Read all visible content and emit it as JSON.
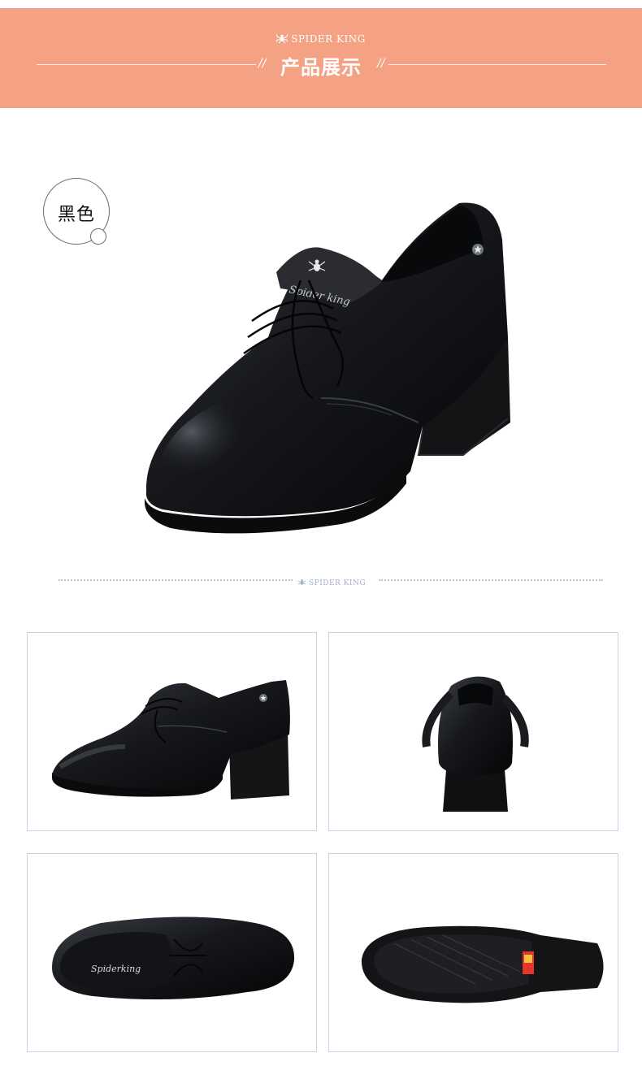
{
  "banner": {
    "brand": "SPIDER KING",
    "title": "产品展示",
    "slash": "//",
    "background": "#f5a184"
  },
  "color_badge": {
    "label": "黑色"
  },
  "hero": {
    "tongue_text": "Spider king"
  },
  "divider": {
    "brand": "SPIDER KING",
    "color": "#b7c0de"
  },
  "thumbnails": {
    "border_color": "#c9d2e6",
    "views": [
      "side-view",
      "back-view",
      "top-view",
      "sole-view"
    ],
    "insole_text": "Spiderking"
  },
  "icons": [
    "spider-icon",
    "star-icon"
  ]
}
